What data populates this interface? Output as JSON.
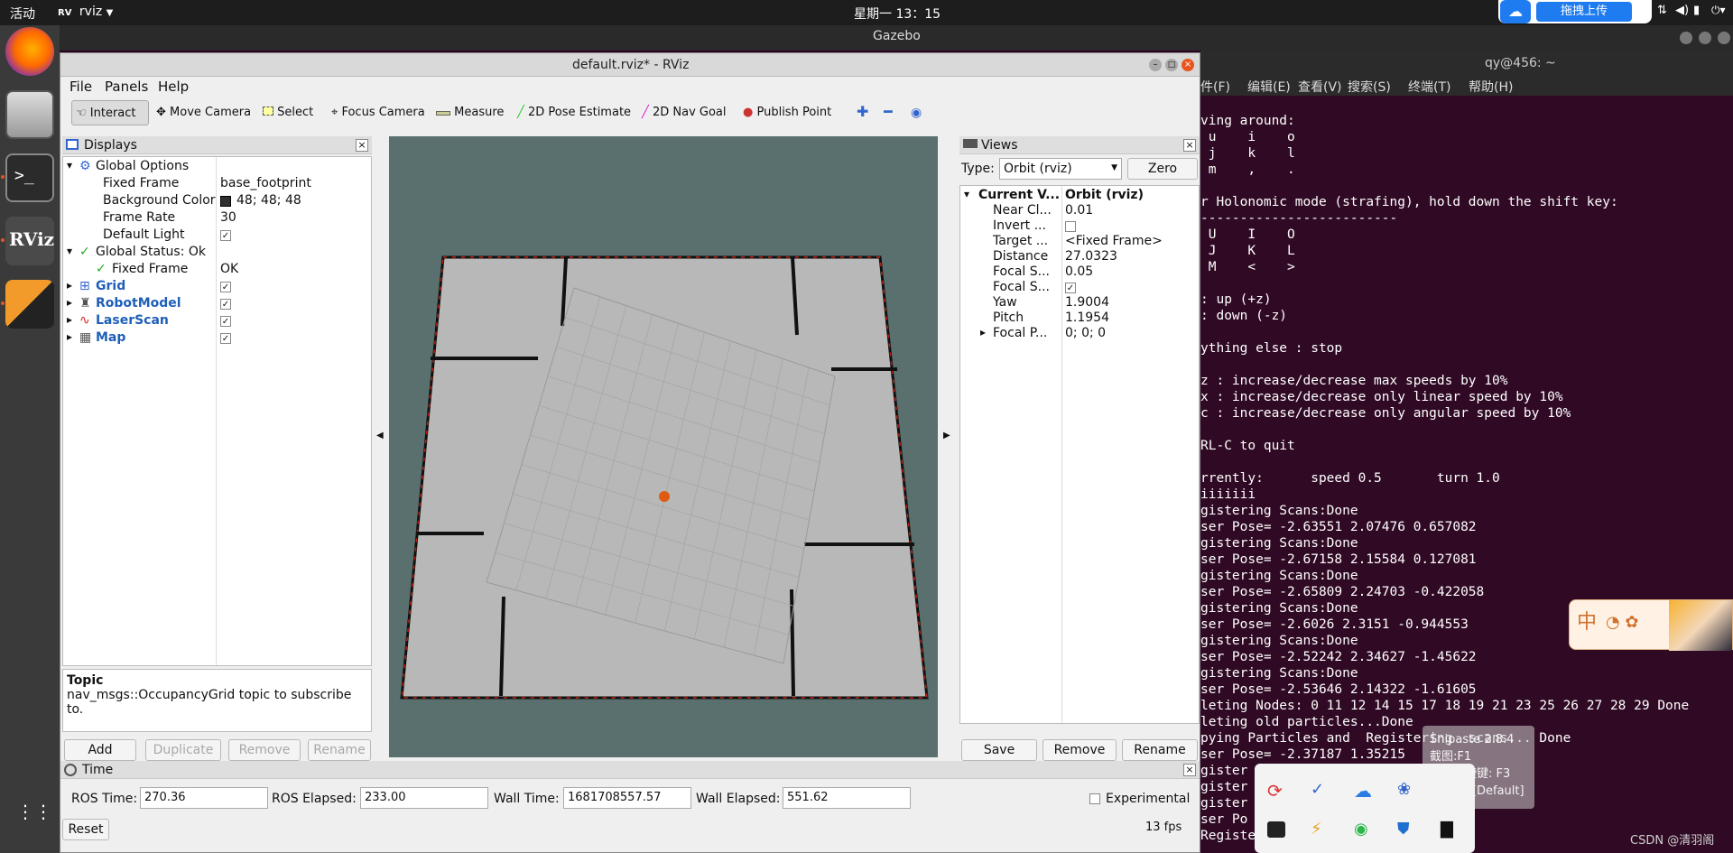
{
  "topbar": {
    "activities": "活动",
    "app": "rviz",
    "clock": "星期一 13：15",
    "upload": "拖拽上传"
  },
  "gazebo": {
    "title": "Gazebo"
  },
  "rviz": {
    "title": "default.rviz* - RViz",
    "menu": [
      "File",
      "Panels",
      "Help"
    ],
    "toolbar": [
      "Interact",
      "Move Camera",
      "Select",
      "Focus Camera",
      "Measure",
      "2D Pose Estimate",
      "2D Nav Goal",
      "Publish Point"
    ],
    "displays": {
      "title": "Displays",
      "rows": [
        {
          "label": "Global Options",
          "value": ""
        },
        {
          "label": "Fixed Frame",
          "value": "base_footprint"
        },
        {
          "label": "Background Color",
          "value": "48; 48; 48"
        },
        {
          "label": "Frame Rate",
          "value": "30"
        },
        {
          "label": "Default Light",
          "value": "✓"
        },
        {
          "label": "Global Status: Ok",
          "value": ""
        },
        {
          "label": "Fixed Frame",
          "value": "OK"
        },
        {
          "label": "Grid",
          "value": "✓"
        },
        {
          "label": "RobotModel",
          "value": "✓"
        },
        {
          "label": "LaserScan",
          "value": "✓"
        },
        {
          "label": "Map",
          "value": "✓"
        }
      ],
      "topic_title": "Topic",
      "topic_desc": "nav_msgs::OccupancyGrid topic to subscribe to.",
      "buttons": [
        "Add",
        "Duplicate",
        "Remove",
        "Rename"
      ]
    },
    "views": {
      "title": "Views",
      "type_label": "Type:",
      "type_value": "Orbit (rviz)",
      "zero": "Zero",
      "rows": [
        {
          "label": "Current V...",
          "value": "Orbit (rviz)"
        },
        {
          "label": "Near Cl...",
          "value": "0.01"
        },
        {
          "label": "Invert ...",
          "value": ""
        },
        {
          "label": "Target ...",
          "value": "<Fixed Frame>"
        },
        {
          "label": "Distance",
          "value": "27.0323"
        },
        {
          "label": "Focal S...",
          "value": "0.05"
        },
        {
          "label": "Focal S...",
          "value": "✓"
        },
        {
          "label": "Yaw",
          "value": "1.9004"
        },
        {
          "label": "Pitch",
          "value": "1.1954"
        },
        {
          "label": "Focal P...",
          "value": "0; 0; 0"
        }
      ],
      "buttons": [
        "Save",
        "Remove",
        "Rename"
      ]
    },
    "time": {
      "title": "Time",
      "ros_time_label": "ROS Time:",
      "ros_time": "270.36",
      "ros_elapsed_label": "ROS Elapsed:",
      "ros_elapsed": "233.00",
      "wall_time_label": "Wall Time:",
      "wall_time": "1681708557.57",
      "wall_elapsed_label": "Wall Elapsed:",
      "wall_elapsed": "551.62",
      "experimental": "Experimental",
      "reset": "Reset",
      "fps": "13 fps"
    }
  },
  "terminal": {
    "title": "qy@456: ~",
    "menu": [
      "件(F)",
      "编辑(E)",
      "查看(V)",
      "搜索(S)",
      "终端(T)",
      "帮助(H)"
    ],
    "lines": [
      "ving around:",
      " u    i    o",
      " j    k    l",
      " m    ,    .",
      "",
      "r Holonomic mode (strafing), hold down the shift key:",
      "-------------------------",
      " U    I    O",
      " J    K    L",
      " M    <    >",
      "",
      ": up (+z)",
      ": down (-z)",
      "",
      "ything else : stop",
      "",
      "z : increase/decrease max speeds by 10%",
      "x : increase/decrease only linear speed by 10%",
      "c : increase/decrease only angular speed by 10%",
      "",
      "RL-C to quit",
      "",
      "rrently:      speed 0.5       turn 1.0",
      "iiiiiii",
      "gistering Scans:Done",
      "ser Pose= -2.63551 2.07476 0.657082",
      "gistering Scans:Done",
      "ser Pose= -2.67158 2.15584 0.127081",
      "gistering Scans:Done",
      "ser Pose= -2.65809 2.24703 -0.422058",
      "gistering Scans:Done",
      "ser Pose= -2.6026 2.3151 -0.944553",
      "gistering Scans:Done",
      "ser Pose= -2.52242 2.34627 -1.45622",
      "gistering Scans:Done",
      "ser Pose= -2.53646 2.14322 -1.61605",
      "leting Nodes: 0 11 12 14 15 17 18 19 21 23 25 26 27 28 29 Done",
      "leting old particles...Done",
      "pying Particles and  Registering  scans... Done",
      "ser Pose= -2.37187 1.35215",
      "gister",
      "gister",
      "gister",
      "ser Po                      11",
      "Register"
    ]
  },
  "snipaste": {
    "title": "Snipaste 2.8.4",
    "l1": "截图:F1",
    "l2": "贴图快捷键: F3",
    "l3": "贴图: 0 [Default]"
  },
  "watermark": "CSDN @清羽阁"
}
